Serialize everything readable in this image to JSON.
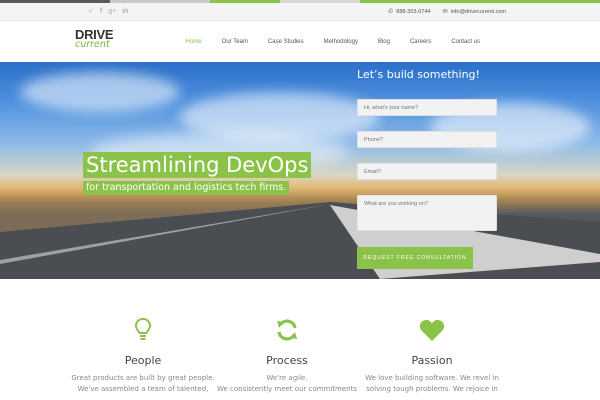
{
  "colors": {
    "accent": "#8bc34a",
    "topbar_bg": "#f4f4f4",
    "text_dark": "#444444"
  },
  "topbar": {
    "social_icons": [
      "twitter-icon",
      "facebook-icon",
      "google-plus-icon",
      "linkedin-icon"
    ],
    "phone_icon": "phone-icon",
    "phone": "888-303-0744",
    "email_icon": "envelope-icon",
    "email": "info@drivecurrent.com"
  },
  "logo": {
    "top": "DRIVE",
    "bottom": "current"
  },
  "nav": {
    "items": [
      {
        "label": "Home"
      },
      {
        "label": "Our Team"
      },
      {
        "label": "Case Studies"
      },
      {
        "label": "Methodology"
      },
      {
        "label": "Blog"
      },
      {
        "label": "Careers"
      },
      {
        "label": "Contact us"
      }
    ],
    "active": "Home"
  },
  "hero": {
    "headline": "Streamlining DevOps",
    "subline": "for transportation and logistics tech firms."
  },
  "form": {
    "title": "Let’s build something!",
    "name_placeholder": "Hi, what's your name?",
    "phone_placeholder": "Phone?",
    "email_placeholder": "Email?",
    "project_placeholder": "What are you working on?",
    "submit_label": "Request free consultation"
  },
  "features": [
    {
      "icon": "lightbulb-icon",
      "title": "People",
      "text_lines": [
        "Great products are built by great people.",
        "We've assembled a team of talented,"
      ]
    },
    {
      "icon": "refresh-icon",
      "title": "Process",
      "text_lines": [
        "We're agile.",
        "We consistently meet our commitments"
      ]
    },
    {
      "icon": "heart-icon",
      "title": "Passion",
      "text_lines": [
        "We love building software. We revel in",
        "solving tough problems. We rejoice in"
      ]
    }
  ]
}
